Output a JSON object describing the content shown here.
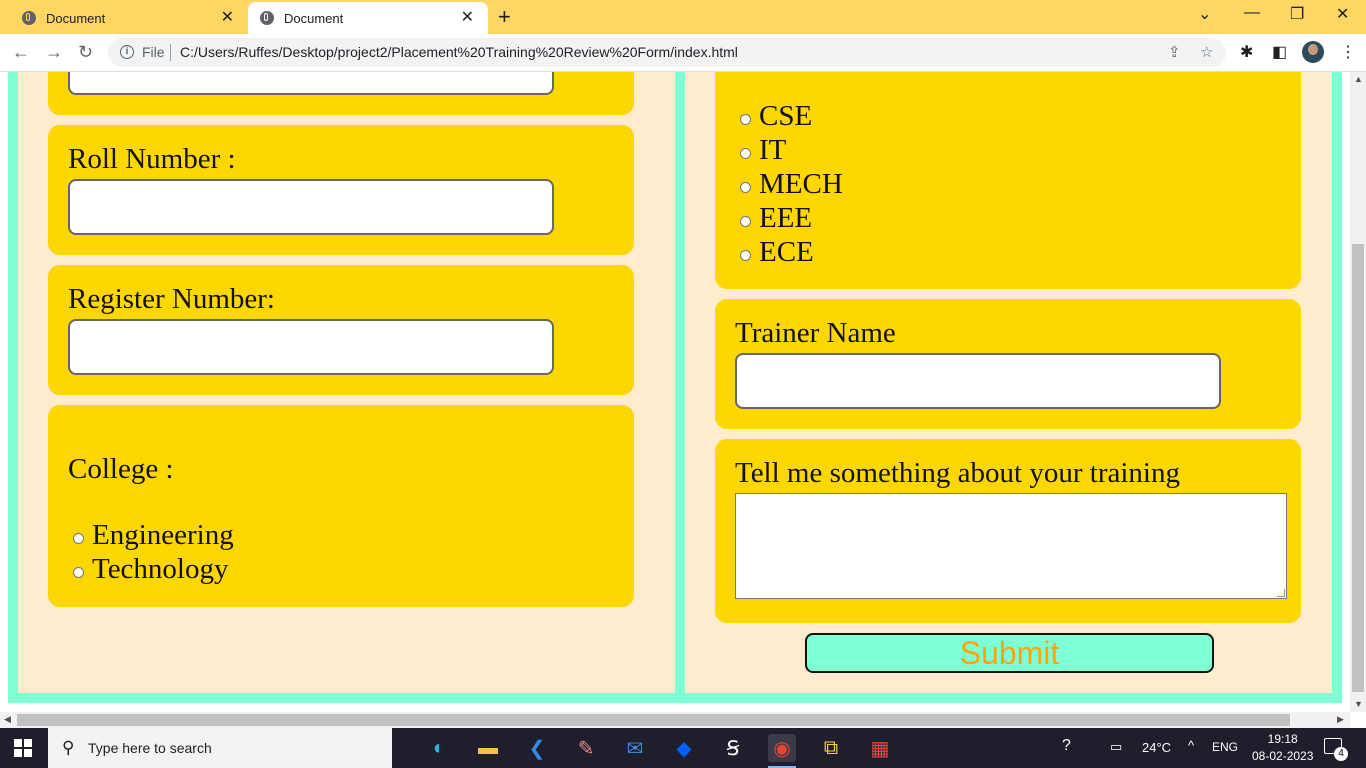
{
  "browser": {
    "tabs": [
      {
        "title": "Document",
        "active": false
      },
      {
        "title": "Document",
        "active": true
      }
    ],
    "scheme_label": "File",
    "url": "C:/Users/Ruffes/Desktop/project2/Placement%20Training%20Review%20Form/index.html"
  },
  "form": {
    "roll_number_label": "Roll Number :",
    "register_number_label": "Register Number:",
    "college_label": "College :",
    "college_options": [
      "Engineering",
      "Technology"
    ],
    "department_options": [
      "CSE",
      "IT",
      "MECH",
      "EEE",
      "ECE"
    ],
    "trainer_name_label": "Trainer Name",
    "feedback_label": "Tell me something about your training",
    "submit_label": "Submit"
  },
  "colors": {
    "page_background": "#ffebcd",
    "border": "#7fffd4",
    "card": "#ffd700",
    "submit_text": "#ffa500",
    "tab_strip": "#fdd663"
  },
  "taskbar": {
    "search_placeholder": "Type here to search",
    "weather": "24°C",
    "language": "ENG",
    "time": "19:18",
    "date": "08-02-2023",
    "notification_count": "4",
    "apps": [
      "edge-icon",
      "file-explorer-icon",
      "vscode-icon",
      "paint-icon",
      "mail-icon",
      "dropbox-icon",
      "sublime-icon",
      "chrome-icon",
      "python-icon",
      "office-icon"
    ]
  }
}
